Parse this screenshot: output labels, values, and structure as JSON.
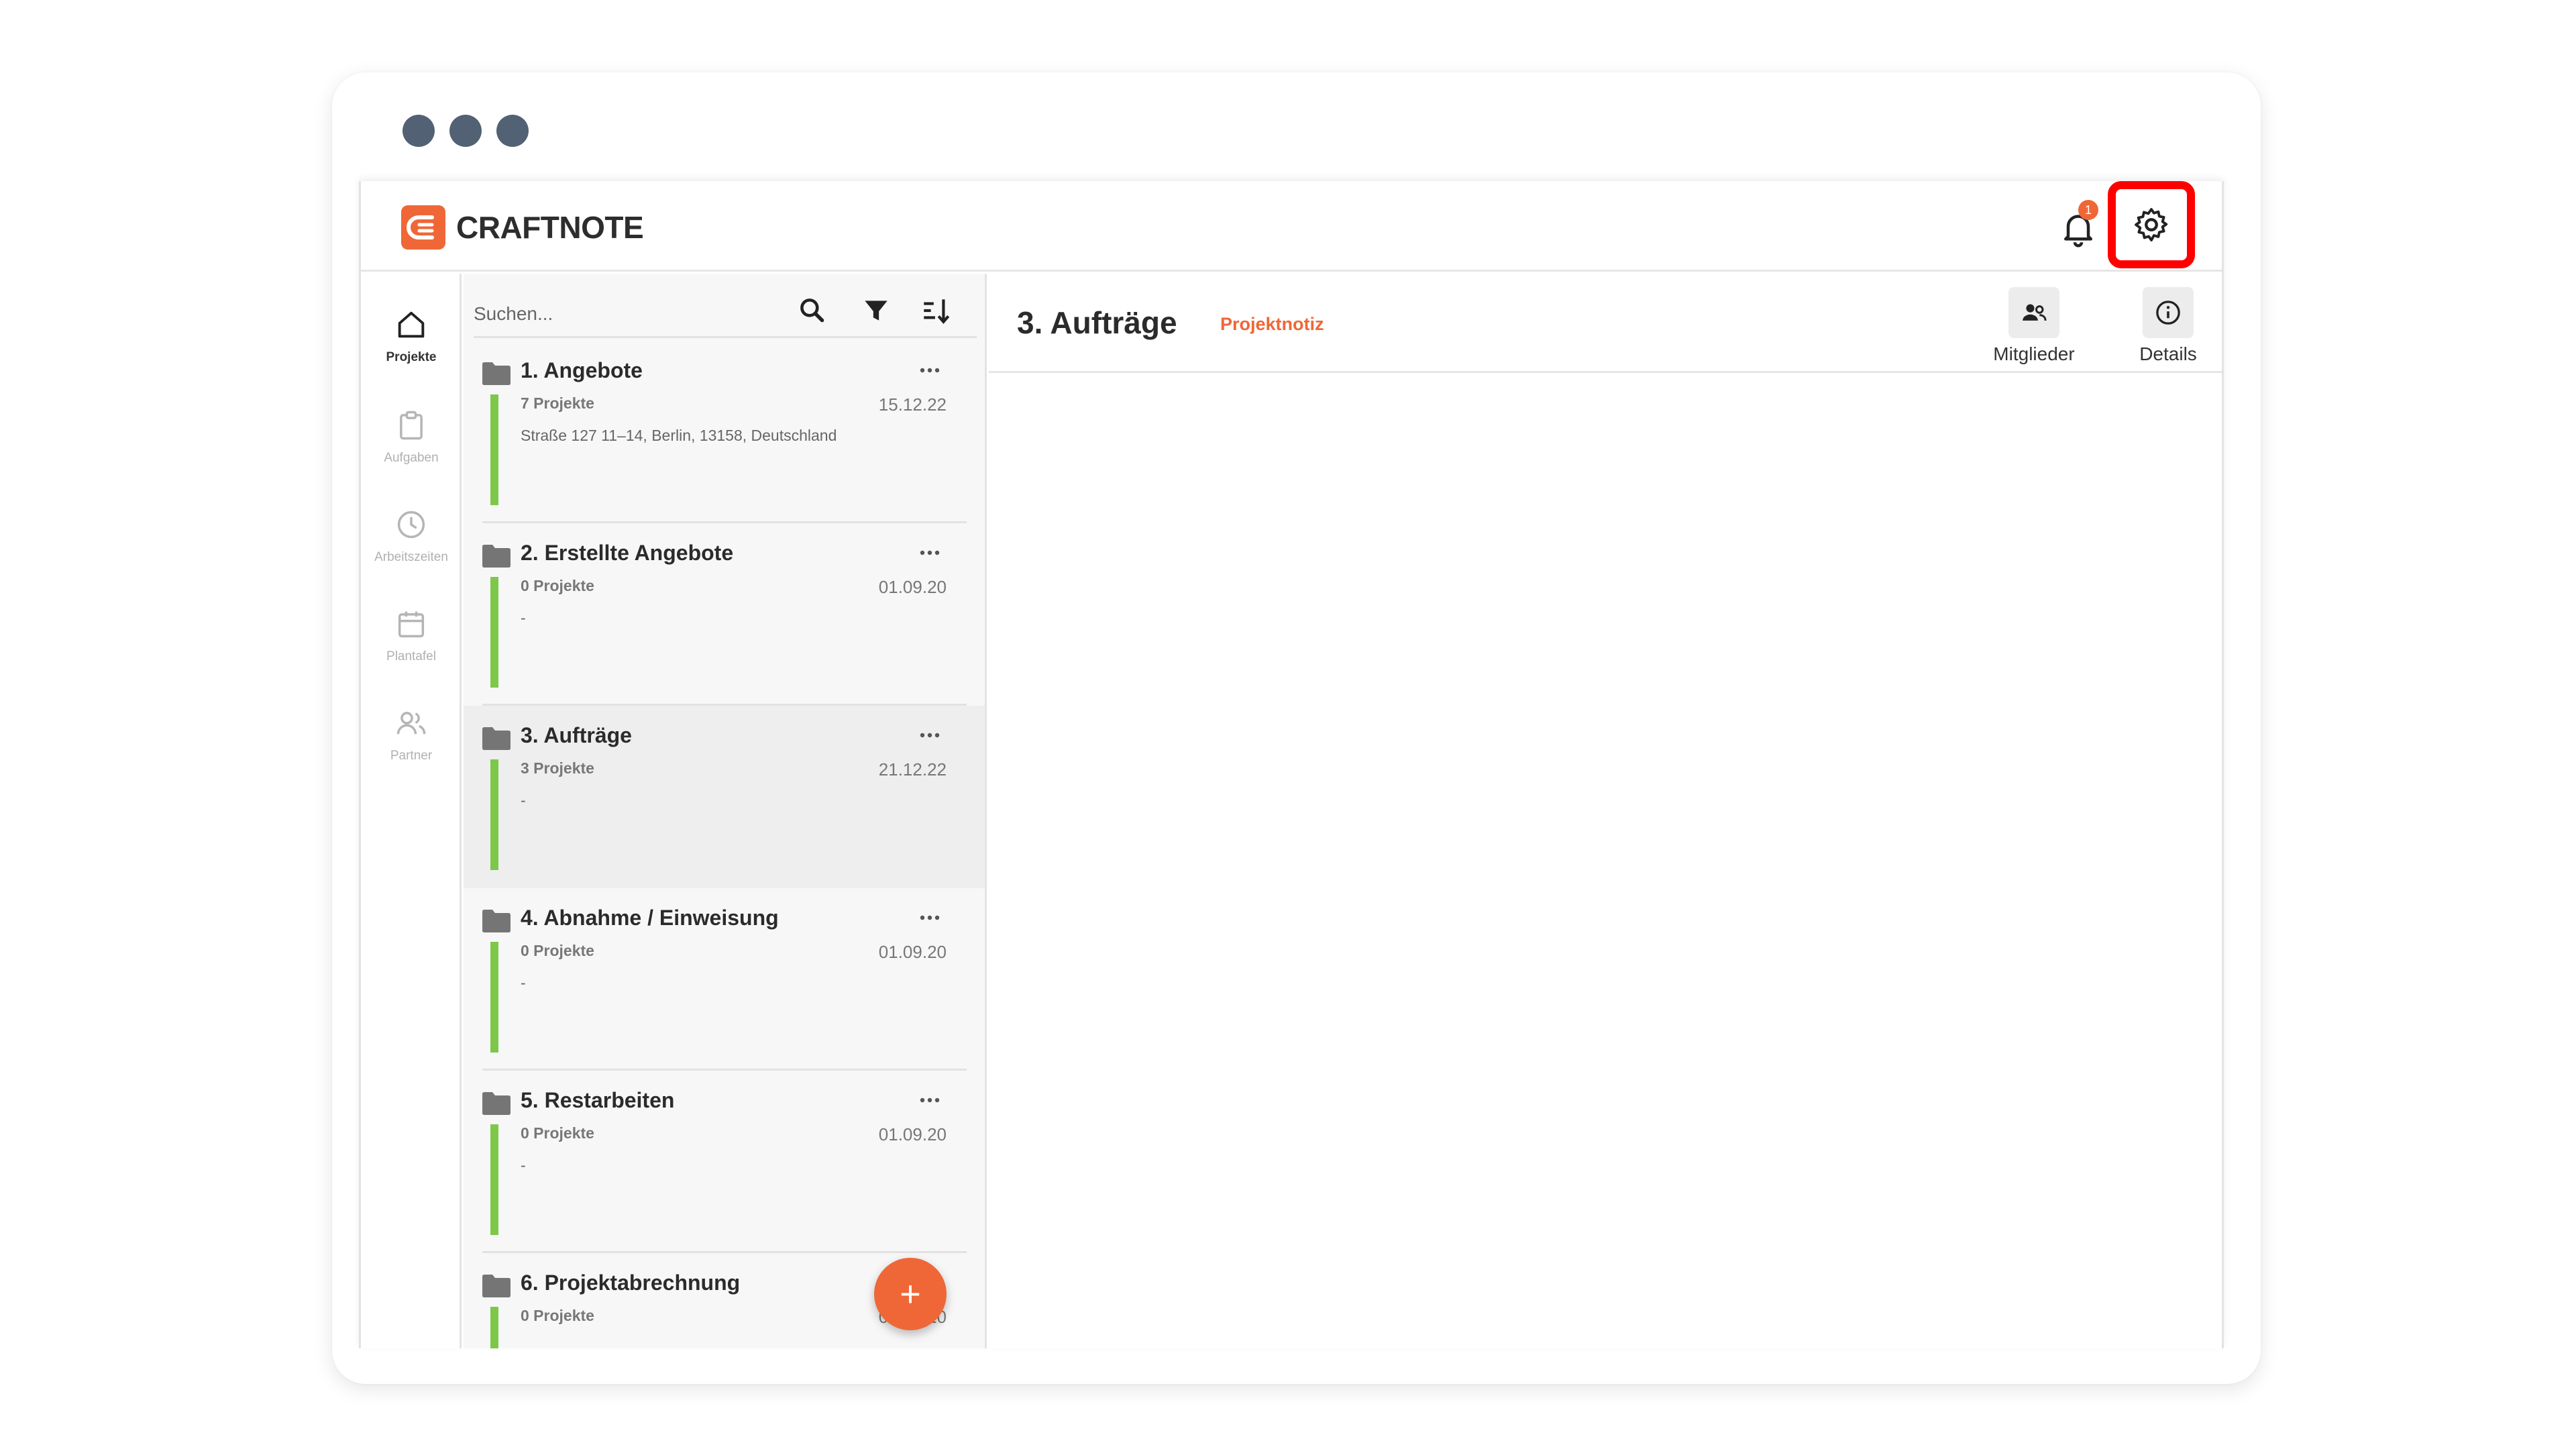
{
  "app": {
    "brand": "CRAFTNOTE",
    "notification_count": "1"
  },
  "nav": {
    "items": [
      {
        "label": "Projekte",
        "icon": "home-icon",
        "active": true
      },
      {
        "label": "Aufgaben",
        "icon": "clipboard-icon",
        "active": false
      },
      {
        "label": "Arbeitszeiten",
        "icon": "clock-icon",
        "active": false
      },
      {
        "label": "Plantafel",
        "icon": "calendar-icon",
        "active": false
      },
      {
        "label": "Partner",
        "icon": "users-icon",
        "active": false
      }
    ]
  },
  "search": {
    "placeholder": "Suchen..."
  },
  "folders": [
    {
      "title": "1. Angebote",
      "count": "7 Projekte",
      "date": "15.12.22",
      "address": "Straße 127 11–14, Berlin, 13158, Deutschland"
    },
    {
      "title": "2. Erstellte Angebote",
      "count": "0 Projekte",
      "date": "01.09.20",
      "address": "-"
    },
    {
      "title": "3. Aufträge",
      "count": "3 Projekte",
      "date": "21.12.22",
      "address": "-"
    },
    {
      "title": "4. Abnahme / Einweisung",
      "count": "0 Projekte",
      "date": "01.09.20",
      "address": "-"
    },
    {
      "title": "5. Restarbeiten",
      "count": "0 Projekte",
      "date": "01.09.20",
      "address": "-"
    },
    {
      "title": "6. Projektabrechnung",
      "count": "0 Projekte",
      "date": "01.09.20",
      "address": ""
    }
  ],
  "fab_label": "+",
  "main": {
    "title": "3. Aufträge",
    "subtitle": "Projektnotiz",
    "actions": [
      {
        "label": "Mitglieder",
        "icon": "members-icon"
      },
      {
        "label": "Details",
        "icon": "info-icon"
      }
    ]
  },
  "colors": {
    "accent": "#ef6737",
    "status_green": "#7dc84a",
    "highlight": "#ff0000"
  }
}
